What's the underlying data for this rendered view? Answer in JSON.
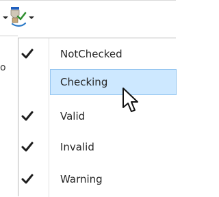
{
  "toolbar": {
    "filter_icon": "status-filter-icon",
    "dropdown_icon": "chevron-down-icon"
  },
  "side_text": "o",
  "menu": {
    "items": [
      {
        "label": "NotChecked",
        "checked": true
      },
      {
        "label": "Checking",
        "checked": false,
        "hovered": true
      },
      {
        "label": "Valid",
        "checked": true
      },
      {
        "label": "Invalid",
        "checked": true
      },
      {
        "label": "Warning",
        "checked": true
      }
    ]
  },
  "colors": {
    "hover_bg": "#cde8ff",
    "hover_border": "#93c4ef",
    "check": "#1e1e1e"
  }
}
